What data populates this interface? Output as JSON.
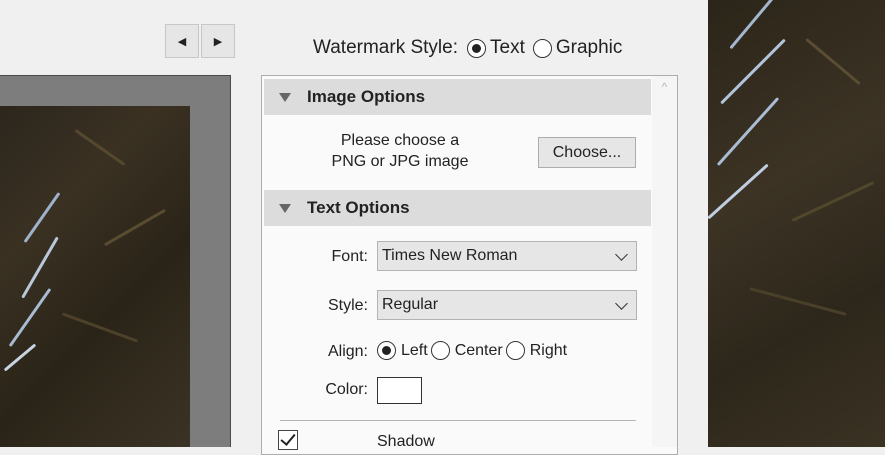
{
  "nav": {
    "prev_icon": "◀",
    "next_icon": "▶"
  },
  "watermark_style": {
    "label": "Watermark Style:",
    "options": [
      "Text",
      "Graphic"
    ],
    "selected": "Text"
  },
  "image_options": {
    "header": "Image Options",
    "prompt_line1": "Please choose a",
    "prompt_line2": "PNG or JPG image",
    "choose_button": "Choose..."
  },
  "text_options": {
    "header": "Text Options",
    "font_label": "Font:",
    "font_value": "Times New Roman",
    "style_label": "Style:",
    "style_value": "Regular",
    "align_label": "Align:",
    "align_options": [
      "Left",
      "Center",
      "Right"
    ],
    "align_selected": "Left",
    "color_label": "Color:",
    "color_value": "#ffffff",
    "shadow_label": "Shadow",
    "shadow_checked": true
  },
  "scrollbar": {
    "up_icon": "^"
  }
}
